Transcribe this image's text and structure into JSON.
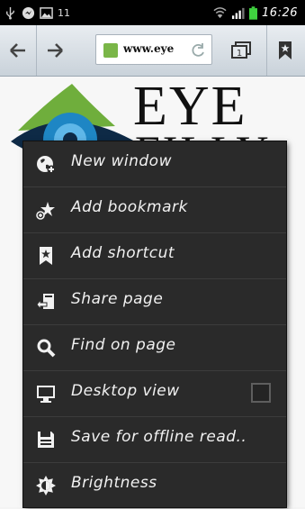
{
  "status_bar": {
    "time": "16:26",
    "notification": "11",
    "icons": [
      "usb-icon",
      "messenger-icon",
      "gallery-icon",
      "wifi-icon",
      "signal-icon",
      "battery-icon"
    ]
  },
  "toolbar": {
    "url": "www.eye",
    "icons": [
      "back-arrow-icon",
      "forward-arrow-icon",
      "refresh-icon",
      "tabs-icon",
      "bookmark-icon"
    ],
    "tab_count": "1"
  },
  "page": {
    "brand_line1": "EYE",
    "brand_line2": "FILLY"
  },
  "menu": {
    "items": [
      {
        "label": "New window",
        "icon": "globe-icon"
      },
      {
        "label": "Add bookmark",
        "icon": "add-bookmark-icon"
      },
      {
        "label": "Add shortcut",
        "icon": "shortcut-icon"
      },
      {
        "label": "Share page",
        "icon": "share-icon"
      },
      {
        "label": "Find on page",
        "icon": "magnifier-icon"
      },
      {
        "label": "Desktop view",
        "icon": "monitor-icon",
        "checked": false
      },
      {
        "label": "Save for offline read..",
        "icon": "save-icon"
      },
      {
        "label": "Brightness",
        "icon": "brightness-icon"
      }
    ]
  },
  "colors": {
    "menu_bg": "#2a2a2a",
    "toolbar_top": "#e9edf1",
    "favicon": "#7ab648",
    "battery": "#3fd23f",
    "logo_green": "#6fae3c",
    "logo_blue": "#1e86c4"
  }
}
